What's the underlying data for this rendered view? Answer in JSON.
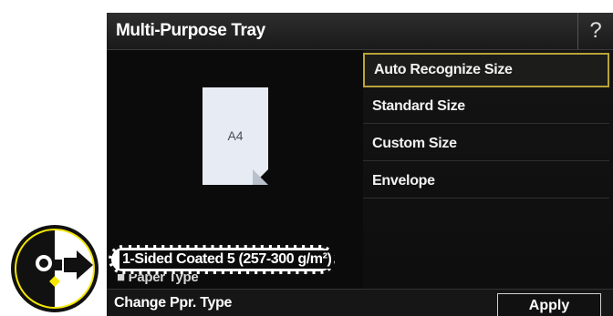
{
  "window": {
    "title": "Multi-Purpose Tray",
    "help_label": "?"
  },
  "preview": {
    "paper_size": "A4"
  },
  "size_options": [
    {
      "label": "Auto Recognize Size",
      "selected": true
    },
    {
      "label": "Standard Size",
      "selected": false
    },
    {
      "label": "Custom Size",
      "selected": false
    },
    {
      "label": "Envelope",
      "selected": false
    }
  ],
  "paper_type": {
    "label": "■ Paper Type",
    "value": "1-Sided Coated 5 (257-300 g/m²)"
  },
  "bottom": {
    "change_label": "Change Ppr. Type",
    "apply_label": "Apply"
  },
  "colors": {
    "screen_bg": "#0b0b0b",
    "selection_border": "#b9a33a",
    "callout_yellow": "#f5e600"
  },
  "icons": {
    "callout": "eye-arrow-icon"
  }
}
